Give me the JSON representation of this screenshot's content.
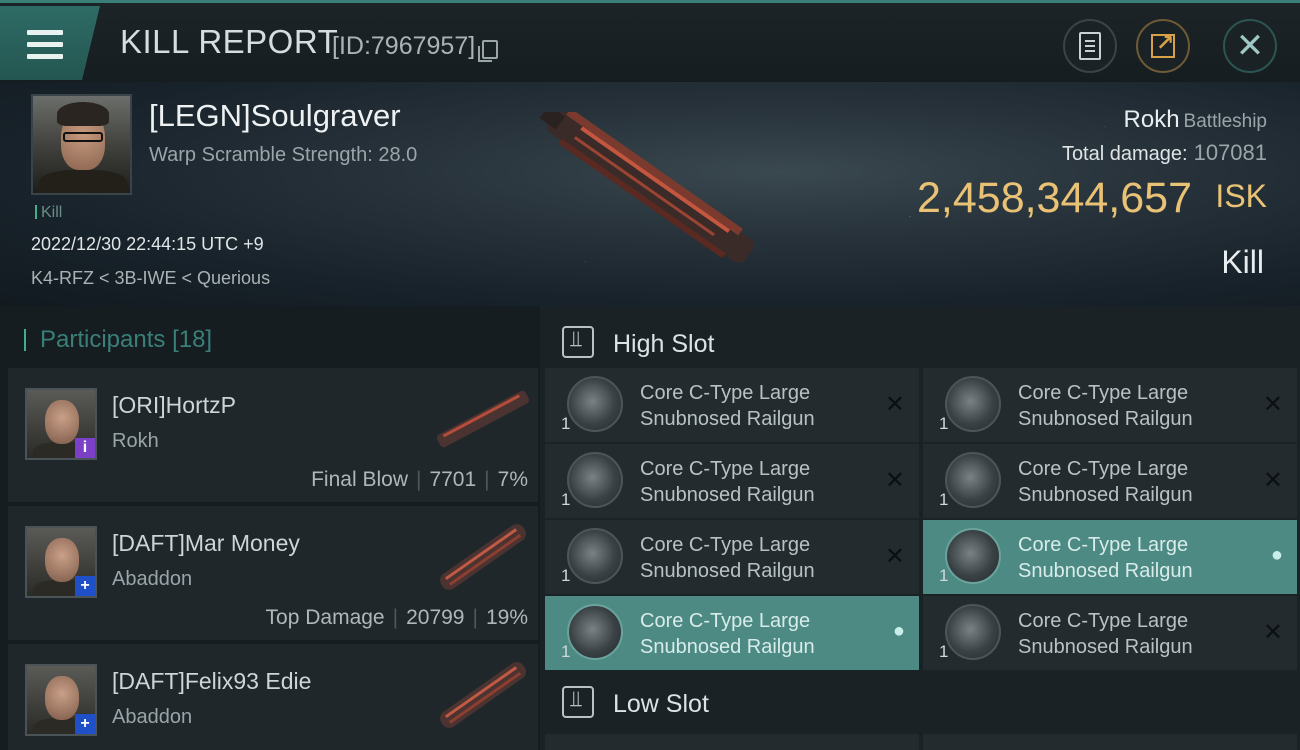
{
  "header": {
    "title": "KILL REPORT",
    "report_id": "[ID:7967957]"
  },
  "victim": {
    "name": "[LEGN]Soulgraver",
    "warp_scramble": "Warp Scramble Strength: 28.0",
    "tag": "Kill",
    "datetime": "2022/12/30 22:44:15 UTC +9",
    "location": "K4-RFZ < 3B-IWE < Querious",
    "ship_name": "Rokh",
    "ship_class": "Battleship",
    "total_damage_label": "Total damage:",
    "total_damage_value": "107081",
    "isk_value": "2,458,344,657",
    "isk_unit": "ISK",
    "result": "Kill"
  },
  "participants": {
    "label": "Participants",
    "count": "[18]",
    "items": [
      {
        "name": "[ORI]HortzP",
        "ship": "Rokh",
        "role": "Final Blow",
        "damage": "7701",
        "percent": "7%",
        "badge": "i"
      },
      {
        "name": "[DAFT]Mar Money",
        "ship": "Abaddon",
        "role": "Top Damage",
        "damage": "20799",
        "percent": "19%",
        "badge": "+"
      },
      {
        "name": "[DAFT]Felix93 Edie",
        "ship": "Abaddon",
        "badge": "+"
      }
    ]
  },
  "fitting": {
    "high_slot_label": "High Slot",
    "low_slot_label": "Low Slot",
    "high_slots": [
      {
        "qty": "1",
        "name_line1": "Core C-Type Large",
        "name_line2": "Snubnosed Railgun",
        "state": "destroyed"
      },
      {
        "qty": "1",
        "name_line1": "Core C-Type Large",
        "name_line2": "Snubnosed Railgun",
        "state": "destroyed"
      },
      {
        "qty": "1",
        "name_line1": "Core C-Type Large",
        "name_line2": "Snubnosed Railgun",
        "state": "destroyed"
      },
      {
        "qty": "1",
        "name_line1": "Core C-Type Large",
        "name_line2": "Snubnosed Railgun",
        "state": "destroyed"
      },
      {
        "qty": "1",
        "name_line1": "Core C-Type Large",
        "name_line2": "Snubnosed Railgun",
        "state": "destroyed"
      },
      {
        "qty": "1",
        "name_line1": "Core C-Type Large",
        "name_line2": "Snubnosed Railgun",
        "state": "dropped"
      },
      {
        "qty": "1",
        "name_line1": "Core C-Type Large",
        "name_line2": "Snubnosed Railgun",
        "state": "dropped"
      },
      {
        "qty": "1",
        "name_line1": "Core C-Type Large",
        "name_line2": "Snubnosed Railgun",
        "state": "destroyed"
      }
    ]
  },
  "icons": {
    "menu": "hamburger-icon",
    "copy": "copy-icon",
    "clipboard": "clipboard-icon",
    "share": "share-icon",
    "close": "close-icon",
    "destroyed": "x-mark-icon",
    "dropped": "person-icon",
    "slot": "slot-icon"
  },
  "colors": {
    "accent": "#3a7f78",
    "isk": "#e9c275",
    "highlight": "#4d8a84"
  }
}
